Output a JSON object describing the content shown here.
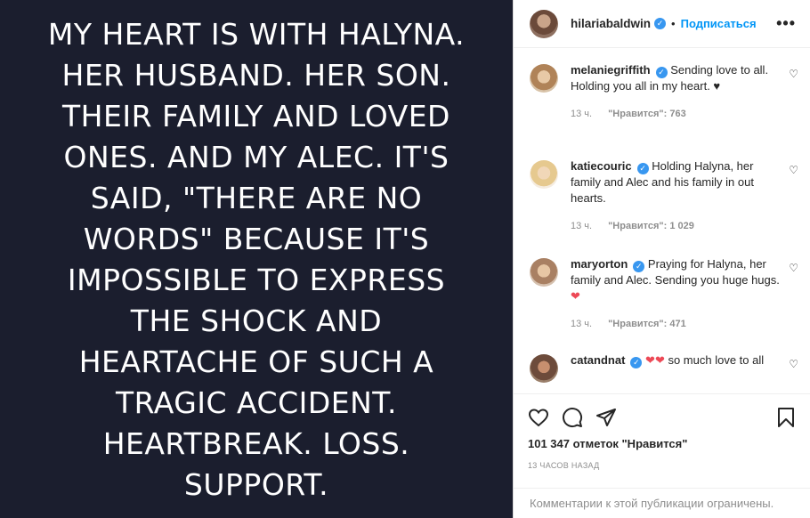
{
  "post": {
    "text_lines": [
      "MY HEART IS WITH HALYNA.",
      "HER HUSBAND. HER SON.",
      "THEIR FAMILY AND LOVED",
      "ONES. AND MY ALEC. IT'S",
      "SAID, \"THERE ARE NO",
      "WORDS\" BECAUSE IT'S",
      "IMPOSSIBLE TO EXPRESS",
      "THE SHOCK AND",
      "HEARTACHE OF SUCH A",
      "TRAGIC ACCIDENT.",
      "HEARTBREAK. LOSS.",
      "SUPPORT."
    ]
  },
  "header": {
    "username": "hilariabaldwin",
    "separator": "•",
    "follow_label": "Подписаться",
    "more_label": "•••"
  },
  "comments": [
    {
      "username": "melaniegriffith",
      "text": "Sending love to all. Holding you all in my heart. ♥",
      "time": "13 ч.",
      "likes": "\"Нравится\": 763"
    },
    {
      "username": "katiecouric",
      "text": "Holding Halyna, her family and Alec and his family in out hearts.",
      "time": "13 ч.",
      "likes": "\"Нравится\": 1 029"
    },
    {
      "username": "maryorton",
      "text": "Praying for Halyna, her family and Alec. Sending you huge hugs.",
      "time": "13 ч.",
      "likes": "\"Нравится\": 471"
    },
    {
      "username": "catandnat",
      "text": "so much love to all"
    }
  ],
  "likes_count": "101 347 отметок \"Нравится\"",
  "posted_time": "13 ЧАСОВ НАЗАД",
  "comments_disabled": "Комментарии к этой публикации ограничены.",
  "colors": {
    "image_bg": "#1b1e2e",
    "accent": "#0095f6",
    "verified": "#3897f0",
    "heart": "#ed4956"
  }
}
